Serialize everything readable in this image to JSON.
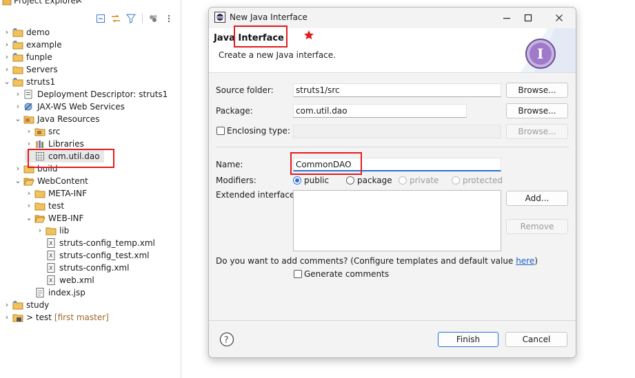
{
  "explorer": {
    "tab_title": "Project Explorer",
    "tab_close": "✕",
    "toolbar_icons": [
      "collapse-all-icon",
      "link-with-editor-icon",
      "filter-icon",
      "view-menu-icon",
      "more-icon"
    ],
    "items": [
      {
        "label": "demo",
        "decoration": ""
      },
      {
        "label": "example",
        "decoration": ""
      },
      {
        "label": "funple",
        "decoration": ""
      },
      {
        "label": "Servers",
        "decoration": ""
      },
      {
        "label": "struts1",
        "decoration": ""
      },
      {
        "label": "Deployment Descriptor: struts1",
        "decoration": ""
      },
      {
        "label": "JAX-WS Web Services",
        "decoration": ""
      },
      {
        "label": "Java Resources",
        "decoration": ""
      },
      {
        "label": "src",
        "decoration": ""
      },
      {
        "label": "Libraries",
        "decoration": ""
      },
      {
        "label": "com.util.dao",
        "decoration": ""
      },
      {
        "label": "build",
        "decoration": ""
      },
      {
        "label": "WebContent",
        "decoration": ""
      },
      {
        "label": "META-INF",
        "decoration": ""
      },
      {
        "label": "test",
        "decoration": ""
      },
      {
        "label": "WEB-INF",
        "decoration": ""
      },
      {
        "label": "lib",
        "decoration": ""
      },
      {
        "label": "struts-config_temp.xml",
        "decoration": ""
      },
      {
        "label": "struts-config_test.xml",
        "decoration": ""
      },
      {
        "label": "struts-config.xml",
        "decoration": ""
      },
      {
        "label": "web.xml",
        "decoration": ""
      },
      {
        "label": "index.jsp",
        "decoration": ""
      },
      {
        "label": "study",
        "decoration": ""
      },
      {
        "label": "> test",
        "decoration": "[first master]"
      }
    ]
  },
  "dialog": {
    "title": "New Java Interface",
    "header": {
      "title_prefix": "Java",
      "title_emph": "Interface",
      "description": "Create a new Java interface."
    },
    "source_folder": {
      "label": "Source folder:",
      "value": "struts1/src",
      "browse": "Browse..."
    },
    "package": {
      "label": "Package:",
      "value": "com.util.dao",
      "browse": "Browse..."
    },
    "enclosing": {
      "label": "Enclosing type:",
      "value": "",
      "browse": "Browse..."
    },
    "name": {
      "label": "Name:",
      "value": "CommonDAO"
    },
    "modifiers": {
      "label": "Modifiers:",
      "options": [
        "public",
        "package",
        "private",
        "protected"
      ],
      "selected": "public"
    },
    "extended": {
      "label": "Extended interfaces:",
      "add": "Add...",
      "remove": "Remove"
    },
    "comments": {
      "question": "Do you want to add comments? (Configure templates and default value ",
      "link": "here",
      "close_paren": ")",
      "checkbox_label": "Generate comments"
    },
    "buttons": {
      "finish": "Finish",
      "cancel": "Cancel",
      "help": "?"
    }
  },
  "colors": {
    "annotation": "#e21b1b",
    "accent": "#2a6ed6",
    "link": "#1a5fc8"
  }
}
